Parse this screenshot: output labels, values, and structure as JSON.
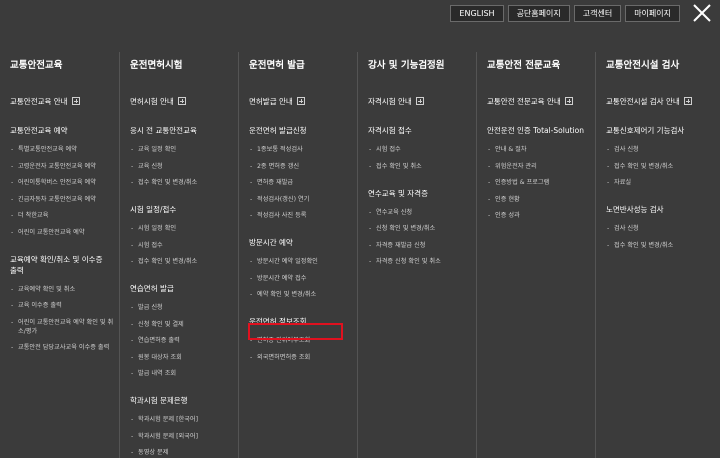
{
  "topbar": {
    "buttons": [
      "ENGLISH",
      "공단홈페이지",
      "고객센터",
      "마이페이지"
    ]
  },
  "columns": [
    {
      "title": "교통안전교육",
      "guide": "교통안전교육 안내",
      "sections": [
        {
          "title": "교통안전교육 예약",
          "items": [
            "특별교통안전교육 예약",
            "고령운전자 교통안전교육 예약",
            "어린이통학버스 안전교육 예약",
            "긴급자동차 교통안전교육 예약",
            "더 착한교육",
            "어린이 교통안전교육 예약"
          ]
        },
        {
          "title": "교육예약 확인/취소 및 이수증 출력",
          "items": [
            "교육예약 확인 및 취소",
            "교육 이수증 출력",
            "어린이 교통안전교육 예약 확인 및 취소/평가",
            "교통안전 담당교사교육 이수증 출력"
          ]
        }
      ]
    },
    {
      "title": "운전면허시험",
      "guide": "면허시험 안내",
      "sections": [
        {
          "title": "응시 전 교통안전교육",
          "items": [
            "교육 일정 확인",
            "교육 신청",
            "접수 확인 및 변경/취소"
          ]
        },
        {
          "title": "시험 일정/접수",
          "items": [
            "시험 일정 확인",
            "시험 접수",
            "접수 확인 및 변경/취소"
          ]
        },
        {
          "title": "연습면허 발급",
          "items": [
            "발급 신청",
            "신청 확인 및 결제",
            "연습면허증 출력",
            "원봉 대상자 조회",
            "발급 내역 조회"
          ]
        },
        {
          "title": "학과시험 문제은행",
          "items": [
            "학과시험 문제 [한국어]",
            "학과시험 문제 [외국어]",
            "동영상 문제"
          ]
        }
      ]
    },
    {
      "title": "운전면허 발급",
      "guide": "면허발급 안내",
      "sections": [
        {
          "title": "운전면허 발급신청",
          "items": [
            "1종보통 적성검사",
            "2종 면허증 갱신",
            "면허증 재발급",
            "적성검사(갱신) 연기",
            "적성검사 사진 등록"
          ]
        },
        {
          "title": "방문시간 예약",
          "items": [
            "방문시간 예약 일정확인",
            "방문시간 예약 접수",
            "예약 확인 및 변경/취소"
          ]
        },
        {
          "title": "운전면허 정보조회",
          "items": [
            "면허증 진위여부조회",
            "외국면허면허증 조회"
          ]
        }
      ]
    },
    {
      "title": "강사 및 기능검정원",
      "guide": "자격시험 안내",
      "sections": [
        {
          "title": "자격시험 접수",
          "items": [
            "시험 접수",
            "접수 확인 및 취소"
          ]
        },
        {
          "title": "연수교육 및 자격증",
          "items": [
            "연수교육 신청",
            "신청 확인 및 변경/취소",
            "자격증 재발급 신청",
            "자격증 신청 확인 및 취소"
          ]
        }
      ]
    },
    {
      "title": "교통안전 전문교육",
      "guide": "교통안전 전문교육 안내",
      "sections": [
        {
          "title": "안전운전 인증 Total-Solution",
          "items": [
            "안내 & 절차",
            "위험운전자 관리",
            "인증방법 & 프로그램",
            "인증 현황",
            "인증 성과"
          ]
        }
      ]
    },
    {
      "title": "교통안전시설 검사",
      "guide": "교통안전시설 검사 안내",
      "sections": [
        {
          "title": "교통신호제어기 기능검사",
          "items": [
            "검사 신청",
            "접수 확인 및 변경/취소",
            "자료실"
          ]
        },
        {
          "title": "노면반사성능 검사",
          "items": [
            "검사 신청",
            "접수 확인 및 변경/취소"
          ]
        }
      ]
    }
  ]
}
